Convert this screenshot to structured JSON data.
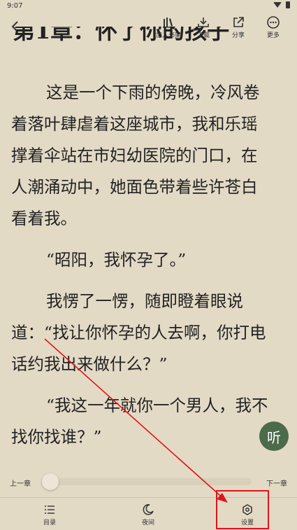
{
  "status_bar": {
    "time": "9:07",
    "wifi_icon": "wifi-icon",
    "battery_icon": "battery-icon"
  },
  "toolbar": {
    "back_icon": "chevron-left-icon",
    "items": [
      {
        "label": "加入书架",
        "icon": "bookshelf-add-icon"
      },
      {
        "label": "下载",
        "icon": "download-icon"
      },
      {
        "label": "分享",
        "icon": "share-icon"
      },
      {
        "label": "更多",
        "icon": "more-icon"
      }
    ]
  },
  "chapter": {
    "title": "第1章：怀了你的孩子"
  },
  "paragraphs": [
    {
      "indent": true,
      "lines": [
        "这是一个下雨的傍晚，冷风卷",
        "着落叶肆虐着这座城市，我和乐瑶",
        "撑着伞站在市妇幼医院的门口，在",
        "人潮涌动中，她面色带着些许苍白",
        "看着我。"
      ]
    },
    {
      "indent": true,
      "lines": [
        "“昭阳，我怀孕了。”"
      ]
    },
    {
      "indent": true,
      "lines": [
        "我愣了一愣，随即瞪着眼说",
        "道：“找让你怀孕的人去啊，你打电",
        "话约我出来做什么？”"
      ]
    },
    {
      "indent": true,
      "lines": [
        "“我这一年就你一个男人，我不",
        "找你找谁？”"
      ]
    }
  ],
  "listen_button": {
    "label": "听"
  },
  "chapter_nav": {
    "prev_label": "上一章",
    "next_label": "下一章",
    "progress": 0
  },
  "bottom_nav": {
    "items": [
      {
        "label": "目录",
        "icon": "list-icon"
      },
      {
        "label": "夜间",
        "icon": "moon-icon"
      },
      {
        "label": "设置",
        "icon": "settings-icon"
      }
    ]
  },
  "colors": {
    "background": "#e3dac6",
    "text": "#222222",
    "listen_button": "#4b6b4b",
    "annotation": "#e0141c"
  }
}
